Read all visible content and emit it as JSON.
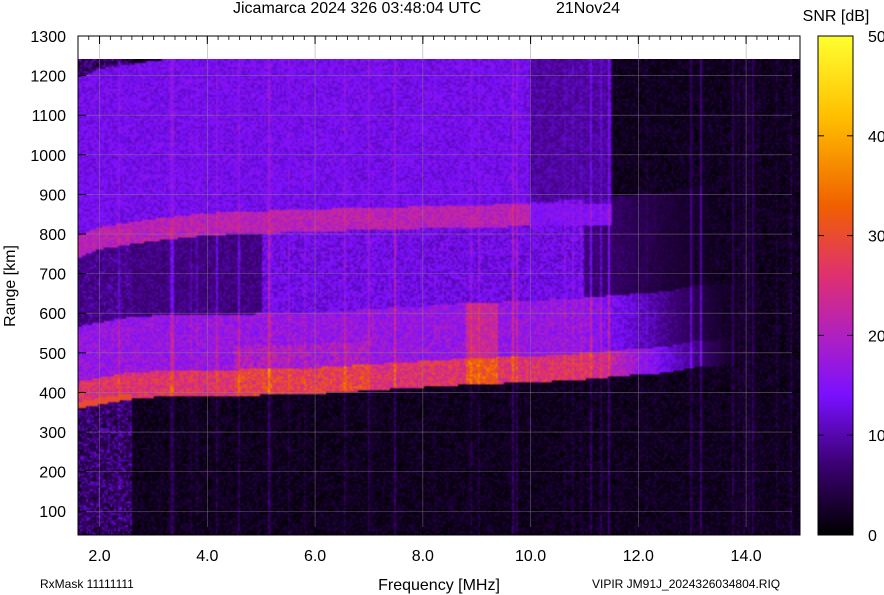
{
  "page": {
    "title_left": "Jicamarca 2024 326 03:48:04 UTC",
    "title_right": "21Nov24",
    "footer_left": "RxMask 11111111",
    "footer_right": "VIPIR  JM91J_2024326034804.RIQ"
  },
  "chart_data": {
    "type": "heatmap",
    "description_of_data": "ionogram (SNR vs frequency and virtual range)",
    "xlabel": "Frequency [MHz]",
    "ylabel": "Range [km]",
    "colorbar_label": "SNR [dB]",
    "xlim": [
      1.6,
      15.0
    ],
    "ylim": [
      40,
      1300
    ],
    "data_xlim": [
      1.6,
      15.0
    ],
    "data_ylim": [
      40,
      1245
    ],
    "zlim": [
      0,
      50
    ],
    "x_ticks": [
      2.0,
      4.0,
      6.0,
      8.0,
      10.0,
      12.0,
      14.0
    ],
    "x_tick_labels": [
      "2.0",
      "4.0",
      "6.0",
      "8.0",
      "10.0",
      "12.0",
      "14.0"
    ],
    "y_ticks": [
      100,
      200,
      300,
      400,
      500,
      600,
      700,
      800,
      900,
      1000,
      1100,
      1200,
      1300
    ],
    "y_tick_labels": [
      "100",
      "200",
      "300",
      "400",
      "500",
      "600",
      "700",
      "800",
      "900",
      "1000",
      "1100",
      "1200",
      "1300"
    ],
    "colorbar_ticks": [
      0,
      10,
      20,
      30,
      40,
      50
    ],
    "colorbar_tick_labels": [
      "0",
      "10",
      "20",
      "30",
      "40",
      "50"
    ],
    "colormap": [
      "#000000",
      "#3a0070",
      "#7a10ff",
      "#b020c0",
      "#e03070",
      "#f06000",
      "#ffc000",
      "#ffff30"
    ],
    "grid": true,
    "echo_traces": [
      {
        "name": "first-hop F-layer trace",
        "freq_mhz": [
          1.6,
          2.0,
          2.5,
          3.0,
          4.0,
          5.0,
          6.0,
          7.0,
          8.0,
          9.0,
          10.0,
          11.0,
          12.0,
          12.5,
          13.0,
          14.0,
          15.0
        ],
        "range_km": [
          368,
          378,
          390,
          395,
          398,
          400,
          403,
          412,
          420,
          428,
          432,
          440,
          452,
          456,
          470,
          480,
          495
        ],
        "peak_snr_db": 28
      },
      {
        "name": "second-hop trace",
        "freq_mhz": [
          1.6,
          2.0,
          3.0,
          4.0,
          5.0,
          6.0,
          7.0,
          8.0,
          9.0,
          10.0,
          11.0
        ],
        "range_km": [
          748,
          770,
          790,
          805,
          810,
          815,
          818,
          822,
          825,
          828,
          830
        ],
        "peak_snr_db": 25
      }
    ]
  }
}
